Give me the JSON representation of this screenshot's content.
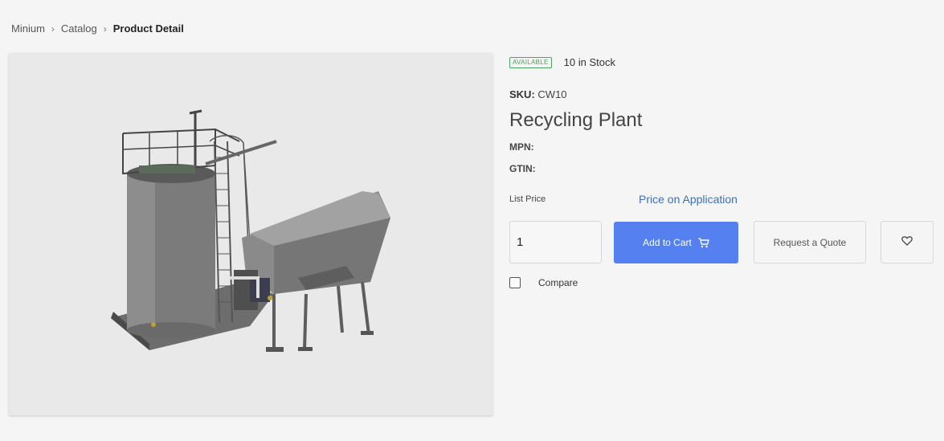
{
  "breadcrumb": {
    "items": [
      "Minium",
      "Catalog"
    ],
    "separator": ">",
    "current": "Product Detail"
  },
  "product": {
    "image_alt": "Recycling Plant",
    "availability_badge": "AVAILABLE",
    "stock_text": "10 in Stock",
    "sku_label": "SKU:",
    "sku_value": "CW10",
    "title": "Recycling Plant",
    "mpn_label": "MPN:",
    "gtin_label": "GTIN:",
    "list_price_label": "List Price",
    "price_value": "Price on Application"
  },
  "actions": {
    "quantity": "1",
    "add_to_cart_label": "Add to Cart",
    "request_quote_label": "Request a Quote",
    "compare_label": "Compare",
    "compare_checked": false
  },
  "icons": {
    "cart": "cart-icon",
    "wishlist": "heart-icon",
    "breadcrumb_separator": "chevron-right-icon"
  },
  "colors": {
    "primary": "#5580ef",
    "available": "#49a35b",
    "price_link": "#3d6fb5",
    "background": "#f5f5f5"
  }
}
